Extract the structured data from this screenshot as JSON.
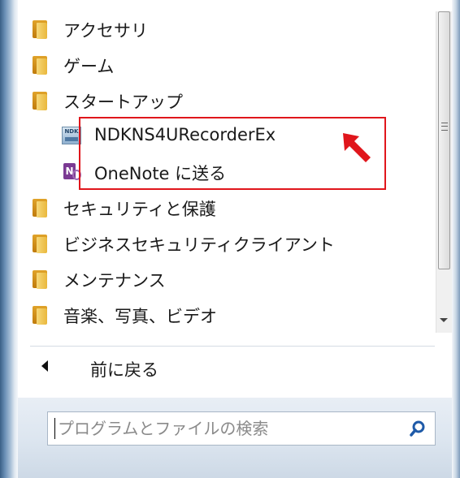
{
  "programs": [
    {
      "label": "アクセサリ",
      "icon": "folder-icon"
    },
    {
      "label": "ゲーム",
      "icon": "folder-icon"
    },
    {
      "label": "スタートアップ",
      "icon": "folder-icon"
    },
    {
      "label": "NDKNS4URecorderEx",
      "icon": "ndk-recorder-icon",
      "icon_text": "NDK"
    },
    {
      "label": "OneNote に送る",
      "icon": "onenote-icon",
      "icon_text": "N"
    },
    {
      "label": "セキュリティと保護",
      "icon": "folder-icon"
    },
    {
      "label": "ビジネスセキュリティクライアント",
      "icon": "folder-icon"
    },
    {
      "label": "メンテナンス",
      "icon": "folder-icon"
    },
    {
      "label": "音楽、写真、ビデオ",
      "icon": "folder-icon"
    }
  ],
  "back": {
    "label": "前に戻る",
    "icon": "back-arrow-icon"
  },
  "search": {
    "placeholder": "プログラムとファイルの検索",
    "value": "",
    "icon": "search-icon"
  },
  "colors": {
    "highlight": "#e0161c",
    "folder": "#e9b73c",
    "search_icon": "#1e5aa8"
  }
}
